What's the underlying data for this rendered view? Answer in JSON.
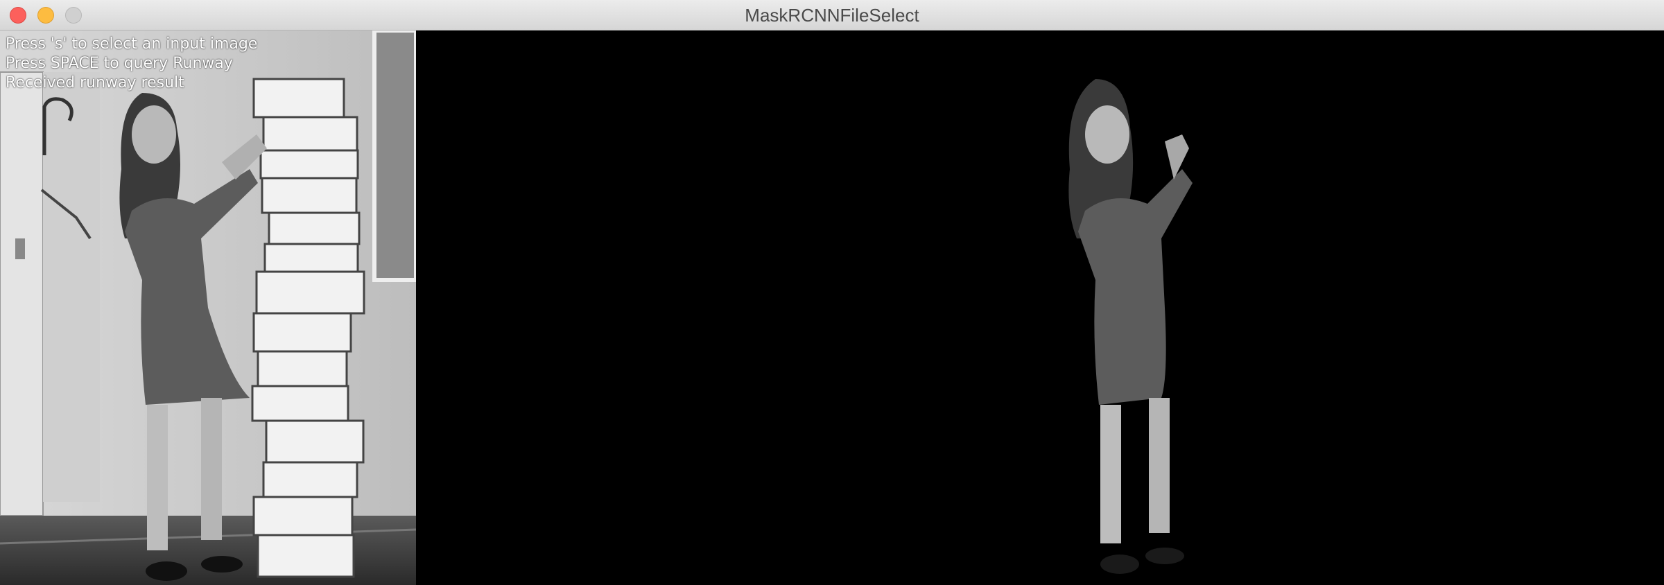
{
  "window": {
    "title": "MaskRCNNFileSelect"
  },
  "overlay": {
    "line1": "Press 's' to select an input image",
    "line2": "Press SPACE to query Runway",
    "line3": "Received runway result"
  },
  "icons": {
    "close": "close-dot-icon",
    "minimize": "minimize-dot-icon",
    "maximize": "maximize-dot-icon"
  },
  "colors": {
    "close": "#fc605c",
    "minimize": "#fdbc40",
    "maximize": "#d0d0d0",
    "background": "#000000"
  }
}
